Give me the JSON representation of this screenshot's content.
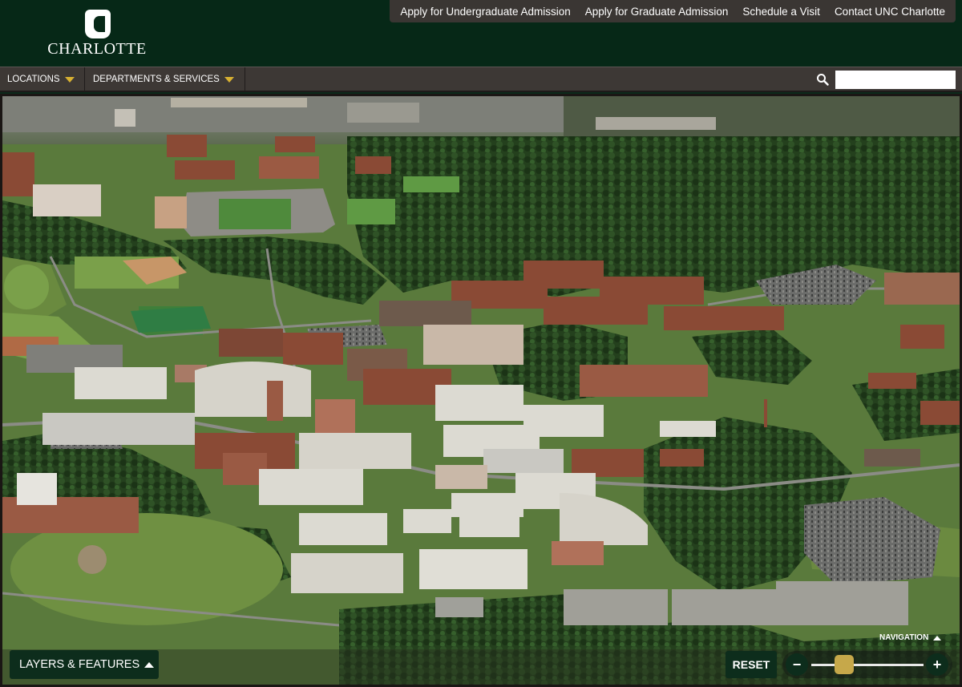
{
  "brand": {
    "wordmark": "CHARLOTTE",
    "colors": {
      "primary_green": "#062817",
      "gold": "#d8b132"
    }
  },
  "top_links": [
    {
      "label": "Apply for Undergraduate Admission"
    },
    {
      "label": "Apply for Graduate Admission"
    },
    {
      "label": "Schedule a Visit"
    },
    {
      "label": "Contact UNC Charlotte"
    }
  ],
  "nav": {
    "locations_label": "LOCATIONS",
    "departments_label": "DEPARTMENTS & SERVICES",
    "search_icon": "search-icon",
    "search_value": ""
  },
  "map_controls": {
    "layers_label": "LAYERS & FEATURES",
    "navigation_label": "NAVIGATION",
    "reset_label": "RESET",
    "zoom_out_label": "−",
    "zoom_in_label": "+",
    "zoom_level": 0.25
  }
}
